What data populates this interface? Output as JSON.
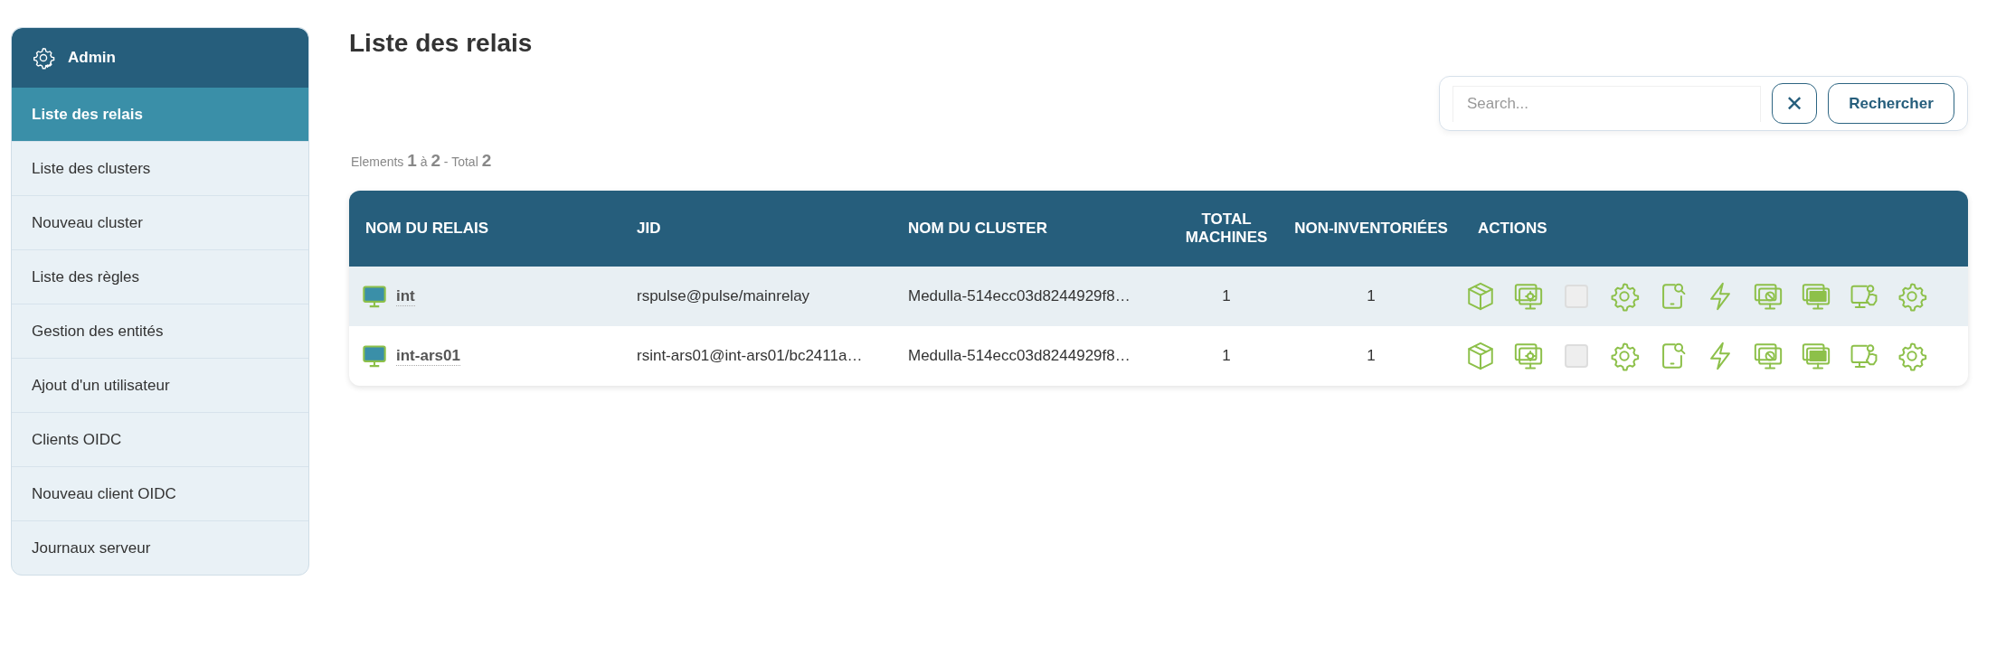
{
  "sidebar": {
    "title": "Admin",
    "items": [
      {
        "label": "Liste des relais",
        "selected": true
      },
      {
        "label": "Liste des clusters",
        "selected": false
      },
      {
        "label": "Nouveau cluster",
        "selected": false
      },
      {
        "label": "Liste des règles",
        "selected": false
      },
      {
        "label": "Gestion des entités",
        "selected": false
      },
      {
        "label": "Ajout d'un utilisateur",
        "selected": false
      },
      {
        "label": "Clients OIDC",
        "selected": false
      },
      {
        "label": "Nouveau client OIDC",
        "selected": false
      },
      {
        "label": "Journaux serveur",
        "selected": false
      }
    ]
  },
  "page_title": "Liste des relais",
  "search": {
    "placeholder": "Search...",
    "clear_label": "✕",
    "button": "Rechercher"
  },
  "pagination": "Elements **1** à **2** - Total **2**",
  "table": {
    "columns": [
      "NOM DU RELAIS",
      "JID",
      "NOM DU CLUSTER",
      "TOTAL MACHINES",
      "NON-INVENTORIÉES",
      "ACTIONS"
    ],
    "rows": [
      {
        "name": "int",
        "jid": "rspulse@pulse/mainrelay",
        "cluster": "Medulla-514ecc03d8244929f8…",
        "total": "1",
        "non_inventoried": "1",
        "actions": [
          {
            "kind": "cube"
          },
          {
            "kind": "monitor-gear"
          },
          {
            "kind": "checkbox",
            "checked": false
          },
          {
            "kind": "gear"
          },
          {
            "kind": "phone-search"
          },
          {
            "kind": "bolt"
          },
          {
            "kind": "monitor-ban"
          },
          {
            "kind": "monitors"
          },
          {
            "kind": "monitor-pointer"
          },
          {
            "kind": "gear"
          }
        ]
      },
      {
        "name": "int-ars01",
        "jid": "rsint-ars01@int-ars01/bc2411a…",
        "cluster": "Medulla-514ecc03d8244929f8…",
        "total": "1",
        "non_inventoried": "1",
        "actions": [
          {
            "kind": "cube"
          },
          {
            "kind": "monitor-gear"
          },
          {
            "kind": "checkbox",
            "checked": false
          },
          {
            "kind": "gear"
          },
          {
            "kind": "phone-search"
          },
          {
            "kind": "bolt"
          },
          {
            "kind": "monitor-ban"
          },
          {
            "kind": "monitors"
          },
          {
            "kind": "monitor-pointer"
          },
          {
            "kind": "gear"
          }
        ]
      }
    ]
  }
}
